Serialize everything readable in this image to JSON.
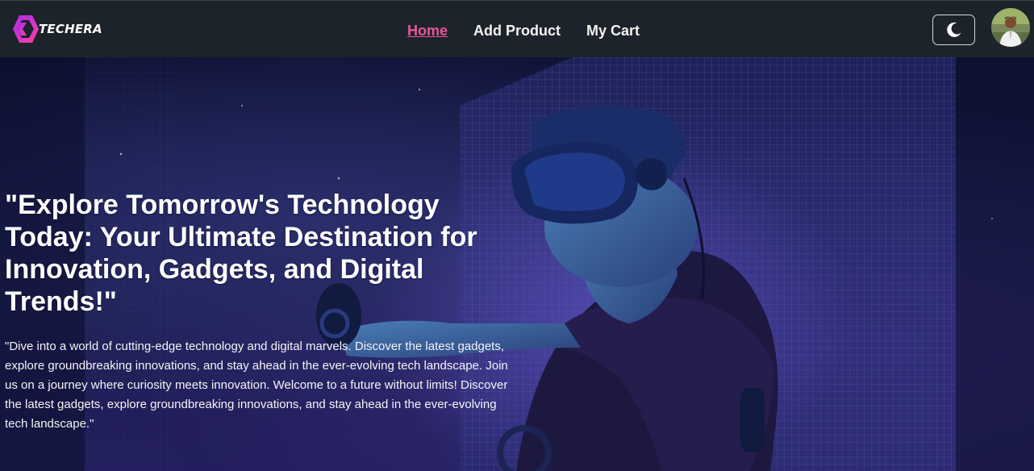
{
  "navbar": {
    "logo_text": "TECHERA",
    "links": [
      {
        "label": "Home",
        "active": true
      },
      {
        "label": "Add Product",
        "active": false
      },
      {
        "label": "My Cart",
        "active": false
      }
    ],
    "theme_toggle_icon": "moon-icon",
    "avatar_icon": "user-avatar"
  },
  "hero": {
    "title": "\"Explore Tomorrow's Technology Today: Your Ultimate Destination for Innovation, Gadgets, and Digital Trends!\"",
    "description": "\"Dive into a world of cutting-edge technology and digital marvels. Discover the latest gadgets, explore groundbreaking innovations, and stay ahead in the ever-evolving tech landscape. Join us on a journey where curiosity meets innovation. Welcome to a future without limits! Discover the latest gadgets, explore groundbreaking innovations, and stay ahead in the ever-evolving tech landscape.\"",
    "background_image": "vr-headset-person"
  },
  "colors": {
    "navbar_bg": "#1d232a",
    "active_link": "#e8569b",
    "hero_bg": "#1a1c4d",
    "logo_gradient": [
      "#a52bf1",
      "#ff3fa4"
    ]
  }
}
